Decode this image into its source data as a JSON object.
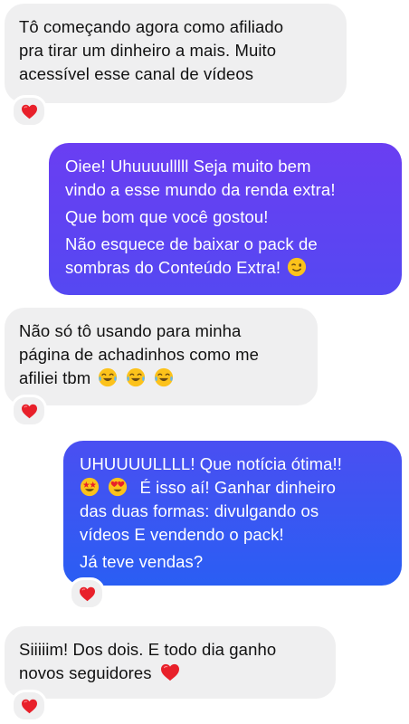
{
  "colors": {
    "incoming_bubble": "#efeff0",
    "outgoing_gradient_top": "#6a3ef2",
    "outgoing_gradient_bottom": "#2a5ef3",
    "heart": "#e8202a"
  },
  "messages": [
    {
      "direction": "incoming",
      "lines": [
        "Tô começando agora como afiliado",
        "pra tirar um dinheiro a mais. Muito",
        "acessível esse canal de vídeos"
      ],
      "reaction": "red-heart"
    },
    {
      "direction": "outgoing",
      "lines": [
        "Oiee! Uhuuuulllll Seja muito bem",
        "vindo a esse mundo da renda extra!",
        "Que bom que você gostou!",
        "Não esquece de baixar o pack de",
        "sombras do Conteúdo Extra!"
      ],
      "trailing_emoji": "winking-face"
    },
    {
      "direction": "incoming",
      "lines": [
        "Não só tô usando para minha",
        "página de achadinhos como me",
        "afiliei tbm"
      ],
      "trailing_emojis": [
        "tears-of-joy",
        "tears-of-joy",
        "tears-of-joy"
      ],
      "reaction": "red-heart"
    },
    {
      "direction": "outgoing",
      "lines": [
        "UHUUUULLLL! Que notícia ótima!!",
        "É isso aí! Ganhar dinheiro",
        "das duas formas: divulgando os",
        "vídeos E vendendo o pack!",
        "Já teve vendas?"
      ],
      "leading_emojis": [
        "star-struck",
        "heart-eyes"
      ],
      "reaction": "red-heart"
    },
    {
      "direction": "incoming",
      "lines": [
        "Siiiiim! Dos dois. E todo dia ganho",
        "novos seguidores"
      ],
      "trailing_emoji": "red-heart",
      "reaction": "red-heart"
    }
  ]
}
